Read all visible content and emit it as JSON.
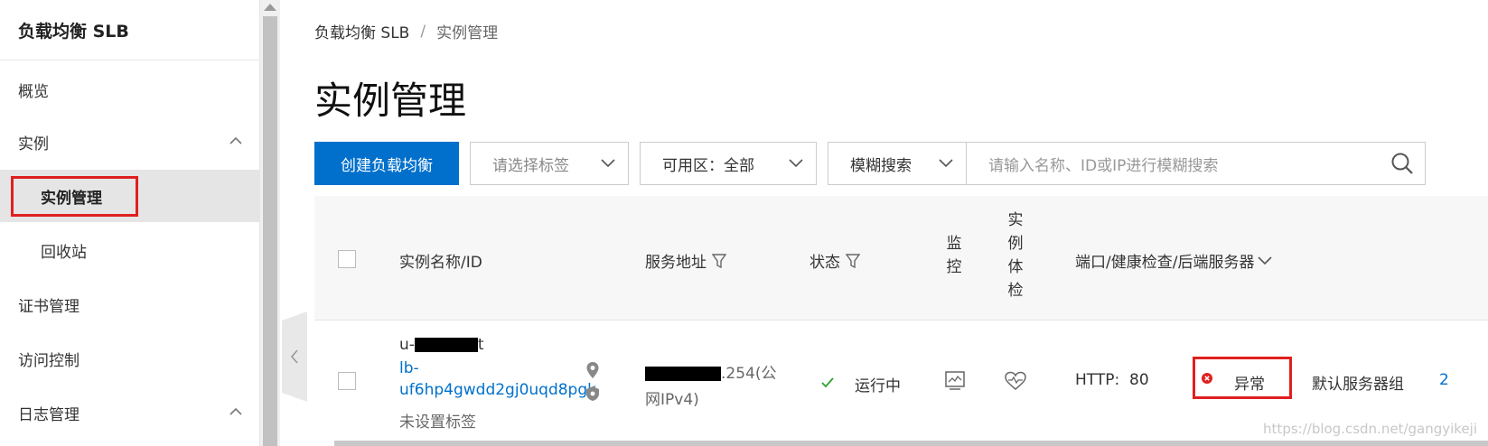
{
  "sidebar": {
    "title": "负载均衡 SLB",
    "items": [
      {
        "label": "概览"
      },
      {
        "label": "实例"
      },
      {
        "label": "实例管理"
      },
      {
        "label": "回收站"
      },
      {
        "label": "证书管理"
      },
      {
        "label": "访问控制"
      },
      {
        "label": "日志管理"
      }
    ]
  },
  "breadcrumb": {
    "root": "负载均衡 SLB",
    "separator": "/",
    "current": "实例管理"
  },
  "page": {
    "title": "实例管理"
  },
  "toolbar": {
    "create_label": "创建负载均衡",
    "tag_select_placeholder": "请选择标签",
    "zone_select_label": "可用区：",
    "zone_select_value": "全部",
    "search_mode_label": "模糊搜索",
    "search_placeholder": "请输入名称、ID或IP进行模糊搜索"
  },
  "table": {
    "columns": {
      "name": "实例名称/ID",
      "address": "服务地址",
      "status": "状态",
      "monitor": [
        "监",
        "控"
      ],
      "health": [
        "实",
        "例",
        "体",
        "检"
      ],
      "port": "端口/健康检查/后端服务器"
    },
    "rows": [
      {
        "name_prefix": "u-",
        "name_suffix": "t",
        "id_line1": "lb-",
        "id_line2": "uf6hp4gwdd2gj0uqd8pgk",
        "tag": "未设置标签",
        "address_suffix": ".254(公",
        "address_line2": "网IPv4)",
        "status": "运行中",
        "protocol": "HTTP:",
        "port": "80",
        "health": "异常",
        "server_group": "默认服务器组",
        "server_count": "2"
      }
    ]
  },
  "watermark": "https://blog.csdn.net/gangyikeji",
  "colors": {
    "primary": "#0070cc",
    "highlight": "#e02020",
    "success": "#2ca02c",
    "error": "#e02020"
  }
}
